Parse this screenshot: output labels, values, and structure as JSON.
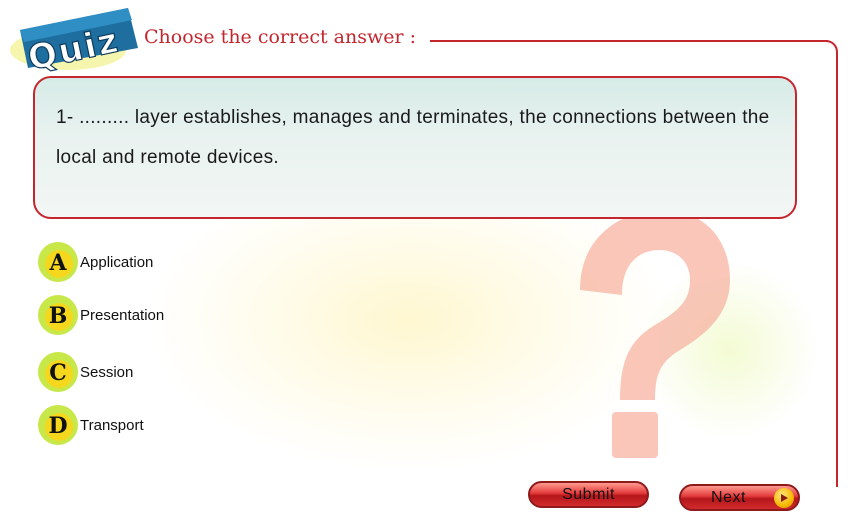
{
  "header": {
    "logo_text": "Quiz",
    "title": "Choose the correct answer :"
  },
  "question": {
    "text": "1- ......... layer establishes, manages and terminates, the connections between the local and remote devices."
  },
  "options": [
    {
      "letter": "A",
      "label": "Application"
    },
    {
      "letter": "B",
      "label": "Presentation"
    },
    {
      "letter": "C",
      "label": "Session"
    },
    {
      "letter": "D",
      "label": "Transport"
    }
  ],
  "buttons": {
    "submit_label": "Submit",
    "next_label": "Next"
  },
  "colors": {
    "accent_red": "#c4262e",
    "badge_green": "#c8e84a",
    "badge_yellow": "#f5d81e",
    "question_mark": "#f6a996"
  }
}
